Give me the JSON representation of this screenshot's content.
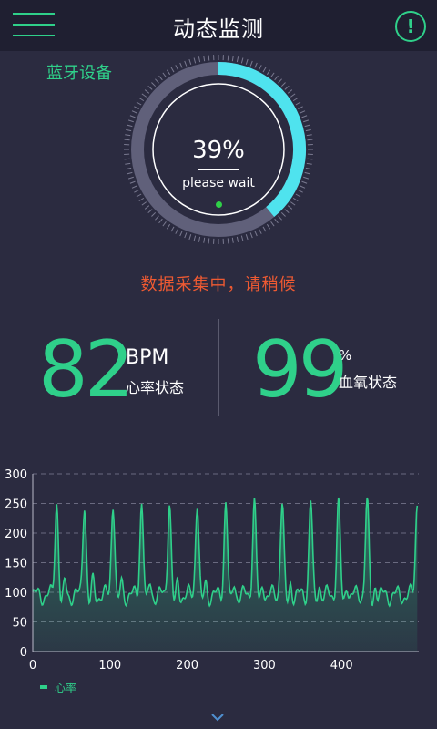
{
  "header": {
    "title": "动态监测",
    "menu_icon": "hamburger-menu-icon",
    "alert_icon": "exclamation-circle-icon"
  },
  "bluetooth": {
    "label": "蓝牙设备"
  },
  "progress": {
    "percent_text": "39%",
    "percent_value": 39,
    "wait_text": "please wait"
  },
  "status_message": "数据采集中，请稍候",
  "heart": {
    "value": "82",
    "unit": "BPM",
    "label": "心率状态"
  },
  "oxygen": {
    "value": "99",
    "unit": "%",
    "label": "血氧状态"
  },
  "colors": {
    "accent": "#2fd08a",
    "ring": "#4fe3ee",
    "status": "#ef5a32",
    "background": "#2b2b40",
    "header": "#1f1f31"
  },
  "chart_data": {
    "type": "line",
    "x_label": "",
    "y_label": "",
    "ylim": [
      0,
      300
    ],
    "xlim": [
      0,
      500
    ],
    "y_ticks": [
      0,
      50,
      100,
      150,
      200,
      250,
      300
    ],
    "x_ticks": [
      0,
      100,
      200,
      300,
      400
    ],
    "grid": "horizontal dashed",
    "legend_position": "bottom-left",
    "series": [
      {
        "name": "心率",
        "color": "#2fd08a",
        "peak_value": 255,
        "baseline_value": 95,
        "peak_x": [
          31,
          67,
          104,
          141,
          177,
          213,
          250,
          287,
          323,
          360,
          396,
          433,
          498
        ]
      }
    ]
  }
}
